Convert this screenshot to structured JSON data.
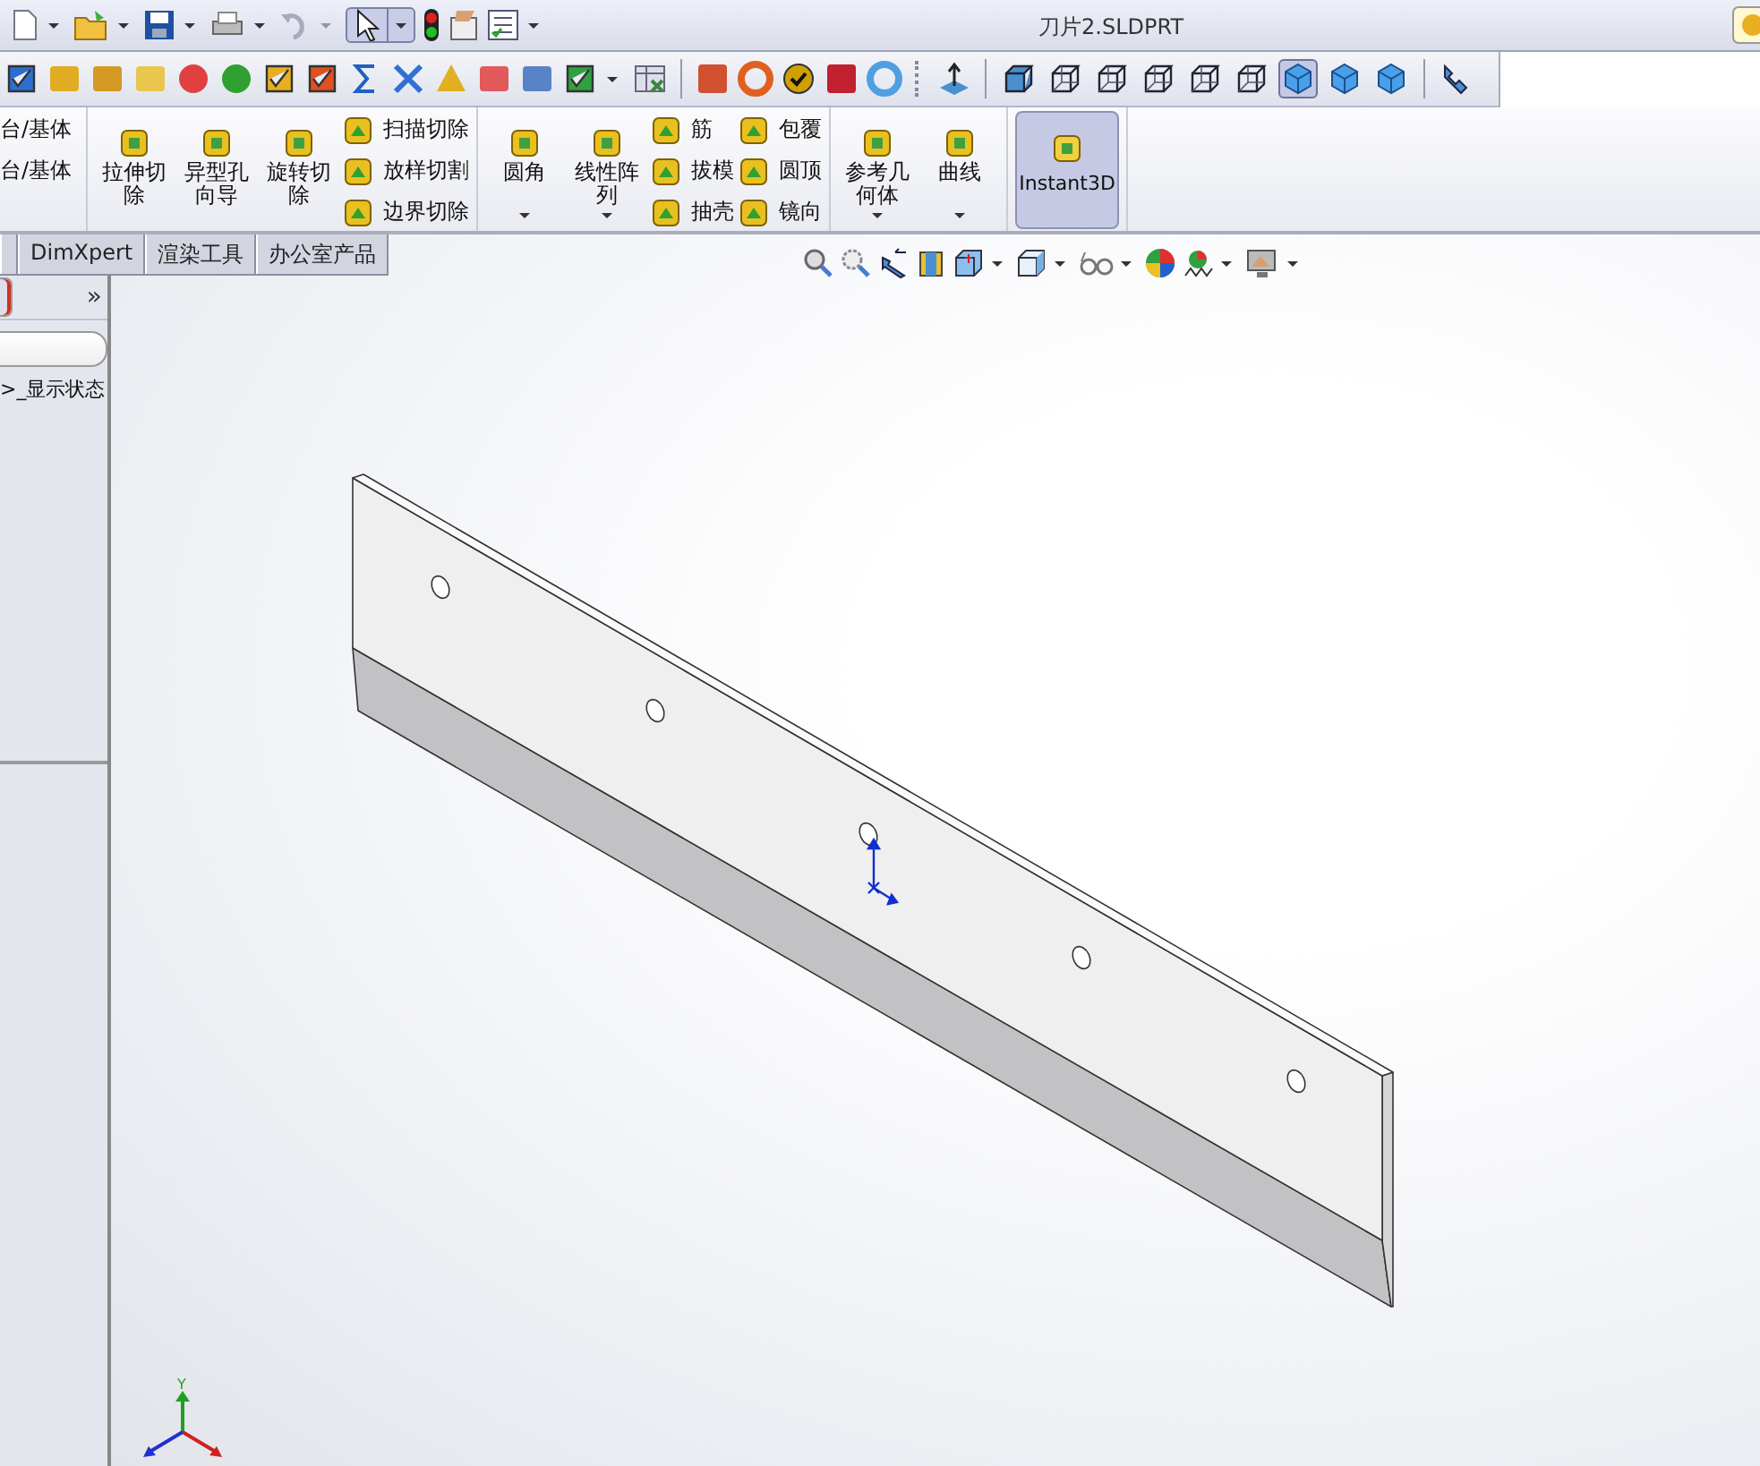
{
  "window": {
    "title": "刀片2.SLDPRT"
  },
  "quick_access": {
    "select_tool_on": true
  },
  "display_styles": [
    {
      "selected": false
    },
    {
      "selected": false
    },
    {
      "selected": false
    },
    {
      "selected": false
    },
    {
      "selected": false
    },
    {
      "selected": false
    },
    {
      "selected": true
    },
    {
      "selected": false
    },
    {
      "selected": false
    }
  ],
  "ribbon": {
    "groups": [
      {
        "blocks": [
          {
            "kind": "column",
            "items": [
              {
                "label": "台/基体"
              },
              {
                "label": "台/基体"
              }
            ]
          }
        ]
      },
      {
        "blocks": [
          {
            "kind": "large",
            "label": "拉伸切除",
            "dropdown": false,
            "on": false
          },
          {
            "kind": "large",
            "label": "异型孔向导",
            "dropdown": false,
            "on": false
          },
          {
            "kind": "large",
            "label": "旋转切除",
            "dropdown": false,
            "on": false
          },
          {
            "kind": "column",
            "items": [
              {
                "label": "扫描切除"
              },
              {
                "label": "放样切割"
              },
              {
                "label": "边界切除"
              }
            ]
          }
        ]
      },
      {
        "blocks": [
          {
            "kind": "large",
            "label": "圆角",
            "dropdown": true,
            "on": false
          },
          {
            "kind": "large",
            "label": "线性阵列",
            "dropdown": true,
            "on": false
          },
          {
            "kind": "column",
            "items": [
              {
                "label": "筋"
              },
              {
                "label": "拔模"
              },
              {
                "label": "抽壳"
              }
            ]
          },
          {
            "kind": "column",
            "items": [
              {
                "label": "包覆"
              },
              {
                "label": "圆顶"
              },
              {
                "label": "镜向"
              }
            ]
          }
        ]
      },
      {
        "blocks": [
          {
            "kind": "large",
            "label": "参考几何体",
            "dropdown": true,
            "on": false
          },
          {
            "kind": "large",
            "label": "曲线",
            "dropdown": true,
            "on": false
          }
        ]
      },
      {
        "blocks": [
          {
            "kind": "large",
            "label": "Instant3D",
            "dropdown": false,
            "on": true
          }
        ]
      }
    ]
  },
  "tabs": [
    {
      "kind": "stub",
      "selected": false
    },
    {
      "kind": "text",
      "label": "DimXpert",
      "selected": false
    },
    {
      "kind": "text",
      "label": "渲染工具",
      "selected": false
    },
    {
      "kind": "text",
      "label": "办公室产品",
      "selected": false
    }
  ],
  "manager": {
    "expand_glyph": "»",
    "tree_item": ">_显示状态"
  },
  "triad": {
    "y_label": "Y"
  }
}
